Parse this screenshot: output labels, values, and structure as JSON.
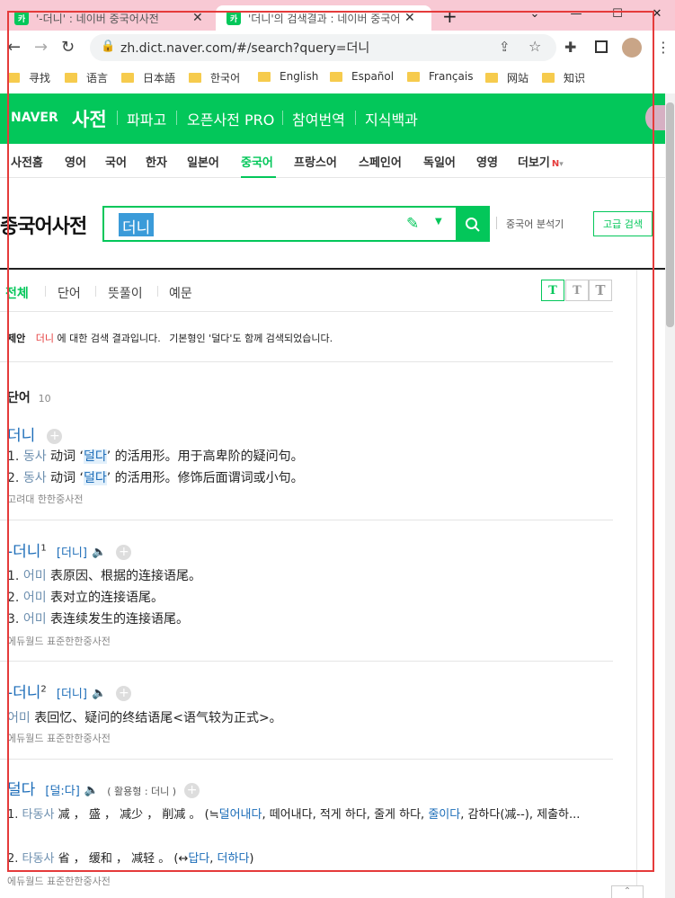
{
  "browser": {
    "tabs": [
      {
        "title": "'-더니' : 네이버 중국어사전",
        "close": "✕"
      },
      {
        "title": "'더니'의 검색결과 : 네이버 중국어",
        "close": "✕"
      }
    ],
    "new_tab": "+",
    "url": "zh.dict.naver.com/#/search?query=더니",
    "bookmarks": [
      "寻找",
      "语言",
      "日本語",
      "한국어",
      "English",
      "Español",
      "Français",
      "网站",
      "知识"
    ]
  },
  "naver": {
    "logo": "NAVER",
    "brand": "사전",
    "menu": [
      "파파고",
      "오픈사전 PRO",
      "참여번역",
      "지식백과"
    ]
  },
  "categories": [
    "사전홈",
    "영어",
    "국어",
    "한자",
    "일본어",
    "중국어",
    "프랑스어",
    "스페인어",
    "독일어",
    "영영",
    "더보기"
  ],
  "more_badge": "N",
  "dict_title": "중국어사전",
  "search": {
    "query": "더니",
    "analyzer": "중국어 분석기",
    "advanced": "고급 검색"
  },
  "result_tabs": [
    "전체",
    "단어",
    "뜻풀이",
    "예문"
  ],
  "text_sizes": [
    "T",
    "T",
    "T"
  ],
  "notice": {
    "label": "제안",
    "query": "더니",
    "text1": "에 대한 검색 결과입니다.",
    "text2": "기본형인 '덜다'도 함께 검색되었습니다."
  },
  "word_section": {
    "title": "단어",
    "count": "10"
  },
  "entries": [
    {
      "headword": "더니",
      "defs": [
        {
          "n": "1.",
          "pos": "동사",
          "pre": "动词 ‘",
          "hl": "덜다",
          "post": "’ 的活用形。用于高卑阶的疑问句。"
        },
        {
          "n": "2.",
          "pos": "동사",
          "pre": "动词 ‘",
          "hl": "덜다",
          "post": "’ 的活用形。修饰后面谓词或小句。"
        }
      ],
      "source": "고려대 한한중사전"
    },
    {
      "headword": "-더니",
      "sup": "1",
      "pron": "[더니]",
      "defs": [
        {
          "n": "1.",
          "pos": "어미",
          "text": "表原因、根据的连接语尾。"
        },
        {
          "n": "2.",
          "pos": "어미",
          "text": "表对立的连接语尾。"
        },
        {
          "n": "3.",
          "pos": "어미",
          "text": "表连续发生的连接语尾。"
        }
      ],
      "source": "에듀월드 표준한한중사전"
    },
    {
      "headword": "-더니",
      "sup": "2",
      "pron": "[더니]",
      "defs": [
        {
          "pos": "어미",
          "text": "表回忆、疑问的终结语尾<语气较为正式>。"
        }
      ],
      "source": "에듀월드 표준한한중사전"
    },
    {
      "headword": "덜다",
      "pron": "[덜:다]",
      "inflection": "( 활용형 : 더니 )",
      "defs": [
        {
          "n": "1.",
          "pos": "타동사",
          "text": "减 ， 盛 ， 减少 ， 削减 。 (≒",
          "link": "덜어내다",
          "text2": ", 떼어내다, 적게 하다, 줄게 하다, ",
          "link2": "줄이다",
          "text3": ", 감하다(减--), 제출하..."
        },
        {
          "n": "2.",
          "pos": "타동사",
          "text": "省 ， 缓和 ， 减轻 。 (↔",
          "link": "답다",
          "text2": ", ",
          "link2": "더하다",
          "text3": ")"
        }
      ],
      "source": "에듀월드 표준한한중사전"
    }
  ],
  "colors": {
    "naver_green": "#03c75a",
    "highlight": "#e53b3b",
    "link_blue": "#1b6cb8"
  }
}
